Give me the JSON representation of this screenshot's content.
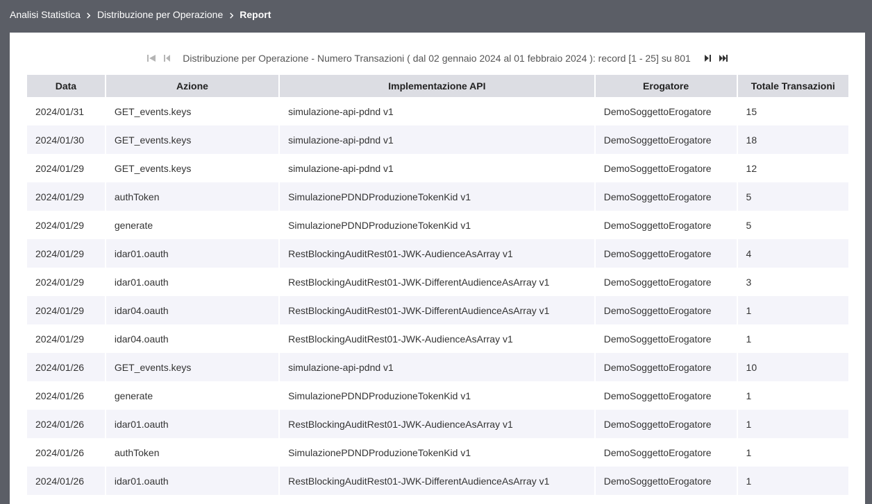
{
  "breadcrumb": {
    "items": [
      "Analisi Statistica",
      "Distribuzione per Operazione"
    ],
    "current": "Report"
  },
  "pager": {
    "summary": "Distribuzione per Operazione - Numero Transazioni ( dal 02 gennaio 2024 al 01 febbraio 2024 ): record [1 - 25] su 801",
    "icons": [
      "first-page-icon",
      "prev-page-icon",
      "next-page-icon",
      "last-page-icon"
    ]
  },
  "table": {
    "headers": [
      "Data",
      "Azione",
      "Implementazione API",
      "Erogatore",
      "Totale Transazioni"
    ],
    "rows": [
      [
        "2024/01/31",
        "GET_events.keys",
        "simulazione-api-pdnd v1",
        "DemoSoggettoErogatore",
        "15"
      ],
      [
        "2024/01/30",
        "GET_events.keys",
        "simulazione-api-pdnd v1",
        "DemoSoggettoErogatore",
        "18"
      ],
      [
        "2024/01/29",
        "GET_events.keys",
        "simulazione-api-pdnd v1",
        "DemoSoggettoErogatore",
        "12"
      ],
      [
        "2024/01/29",
        "authToken",
        "SimulazionePDNDProduzioneTokenKid v1",
        "DemoSoggettoErogatore",
        "5"
      ],
      [
        "2024/01/29",
        "generate",
        "SimulazionePDNDProduzioneTokenKid v1",
        "DemoSoggettoErogatore",
        "5"
      ],
      [
        "2024/01/29",
        "idar01.oauth",
        "RestBlockingAuditRest01-JWK-AudienceAsArray v1",
        "DemoSoggettoErogatore",
        "4"
      ],
      [
        "2024/01/29",
        "idar01.oauth",
        "RestBlockingAuditRest01-JWK-DifferentAudienceAsArray v1",
        "DemoSoggettoErogatore",
        "3"
      ],
      [
        "2024/01/29",
        "idar04.oauth",
        "RestBlockingAuditRest01-JWK-DifferentAudienceAsArray v1",
        "DemoSoggettoErogatore",
        "1"
      ],
      [
        "2024/01/29",
        "idar04.oauth",
        "RestBlockingAuditRest01-JWK-AudienceAsArray v1",
        "DemoSoggettoErogatore",
        "1"
      ],
      [
        "2024/01/26",
        "GET_events.keys",
        "simulazione-api-pdnd v1",
        "DemoSoggettoErogatore",
        "10"
      ],
      [
        "2024/01/26",
        "generate",
        "SimulazionePDNDProduzioneTokenKid v1",
        "DemoSoggettoErogatore",
        "1"
      ],
      [
        "2024/01/26",
        "idar01.oauth",
        "RestBlockingAuditRest01-JWK-AudienceAsArray v1",
        "DemoSoggettoErogatore",
        "1"
      ],
      [
        "2024/01/26",
        "authToken",
        "SimulazionePDNDProduzioneTokenKid v1",
        "DemoSoggettoErogatore",
        "1"
      ],
      [
        "2024/01/26",
        "idar01.oauth",
        "RestBlockingAuditRest01-JWK-DifferentAudienceAsArray v1",
        "DemoSoggettoErogatore",
        "1"
      ]
    ]
  }
}
